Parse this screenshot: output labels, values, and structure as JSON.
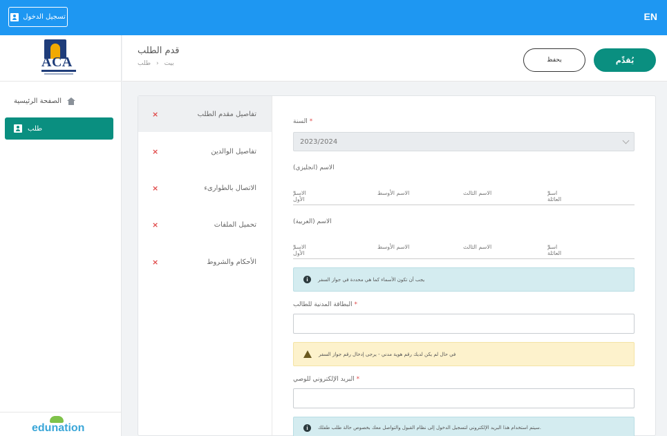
{
  "topbar": {
    "lang": "EN",
    "login_label": "تسجيل الدخول"
  },
  "sidebar": {
    "logo_text": "ACA",
    "home_label": "الصفحة الرئيسية",
    "request_label": "طلب",
    "brand": "edunation"
  },
  "header": {
    "title": "قدم الطلب",
    "breadcrumb": [
      "طلب",
      "›",
      "بيت"
    ],
    "save_label": "يحفظ",
    "submit_label": "يُقدِّم"
  },
  "steps": [
    {
      "label": "تفاصيل مقدم الطلب",
      "mark": "×"
    },
    {
      "label": "تفاصيل الوالدين",
      "mark": "×"
    },
    {
      "label": "الاتصال بالطوارىء",
      "mark": "×"
    },
    {
      "label": "تحميل الملفات",
      "mark": "×"
    },
    {
      "label": "الأحكام والشروط",
      "mark": "×"
    }
  ],
  "form": {
    "year_label": "السنة",
    "year_value": "2023/2024",
    "name_en_label": "الاسم (انجليزي)",
    "name_ar_label": "الاسم (العربية)",
    "name_fields": [
      "الاسم الأول",
      "الاسم الأوسط",
      "الاسم الثالث",
      "اسم العائلة"
    ],
    "names_info": "يجب أن تكون الأسماء كما هي محددة في جواز السفر",
    "civil_id_label": "البطاقة المدنية للطالب",
    "civil_id_warning": "في حال لم يكن لديك رقم هوية مدني - يرجى إدخال رقم جواز السفر",
    "email_label": "البريد الإلكتروني للوصي",
    "email_info": "سيتم استخدام هذا البريد الإلكتروني لتسجيل الدخول إلى نظام القبول والتواصل معك بخصوص حالة طلب طفلك."
  },
  "colors": {
    "topbar": "#1e97f2",
    "accent": "#0a8f80",
    "error": "#e04a4a"
  }
}
